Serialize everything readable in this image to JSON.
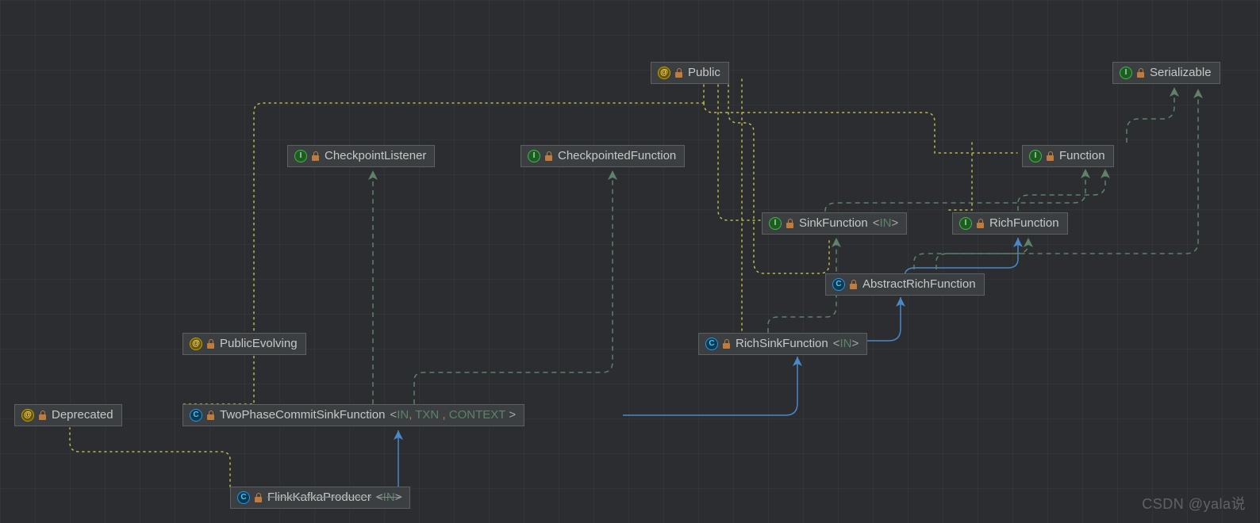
{
  "nodes": {
    "public": {
      "name": "Public",
      "kind": "annotation"
    },
    "serializable": {
      "name": "Serializable",
      "kind": "interface"
    },
    "ckListener": {
      "name": "CheckpointListener",
      "kind": "interface"
    },
    "ckFunction": {
      "name": "CheckpointedFunction",
      "kind": "interface"
    },
    "function": {
      "name": "Function",
      "kind": "interface"
    },
    "sinkFn": {
      "name": "SinkFunction",
      "generics": "<IN>",
      "kind": "interface"
    },
    "richFn": {
      "name": "RichFunction",
      "kind": "interface"
    },
    "absRichFn": {
      "name": "AbstractRichFunction",
      "kind": "class"
    },
    "richSinkFn": {
      "name": "RichSinkFunction",
      "generics": "<IN>",
      "kind": "class"
    },
    "pubEvolving": {
      "name": "PublicEvolving",
      "kind": "annotation"
    },
    "tpcSinkFn": {
      "name": "TwoPhaseCommitSinkFunction",
      "generics": "<IN, TXN, CONTEXT >",
      "kind": "class"
    },
    "deprecated": {
      "name": "Deprecated",
      "kind": "annotation"
    },
    "flinkKafka": {
      "name": "FlinkKafkaProducer",
      "generics": "<IN>",
      "kind": "class",
      "strike": true
    }
  },
  "watermark": "CSDN @yala说"
}
